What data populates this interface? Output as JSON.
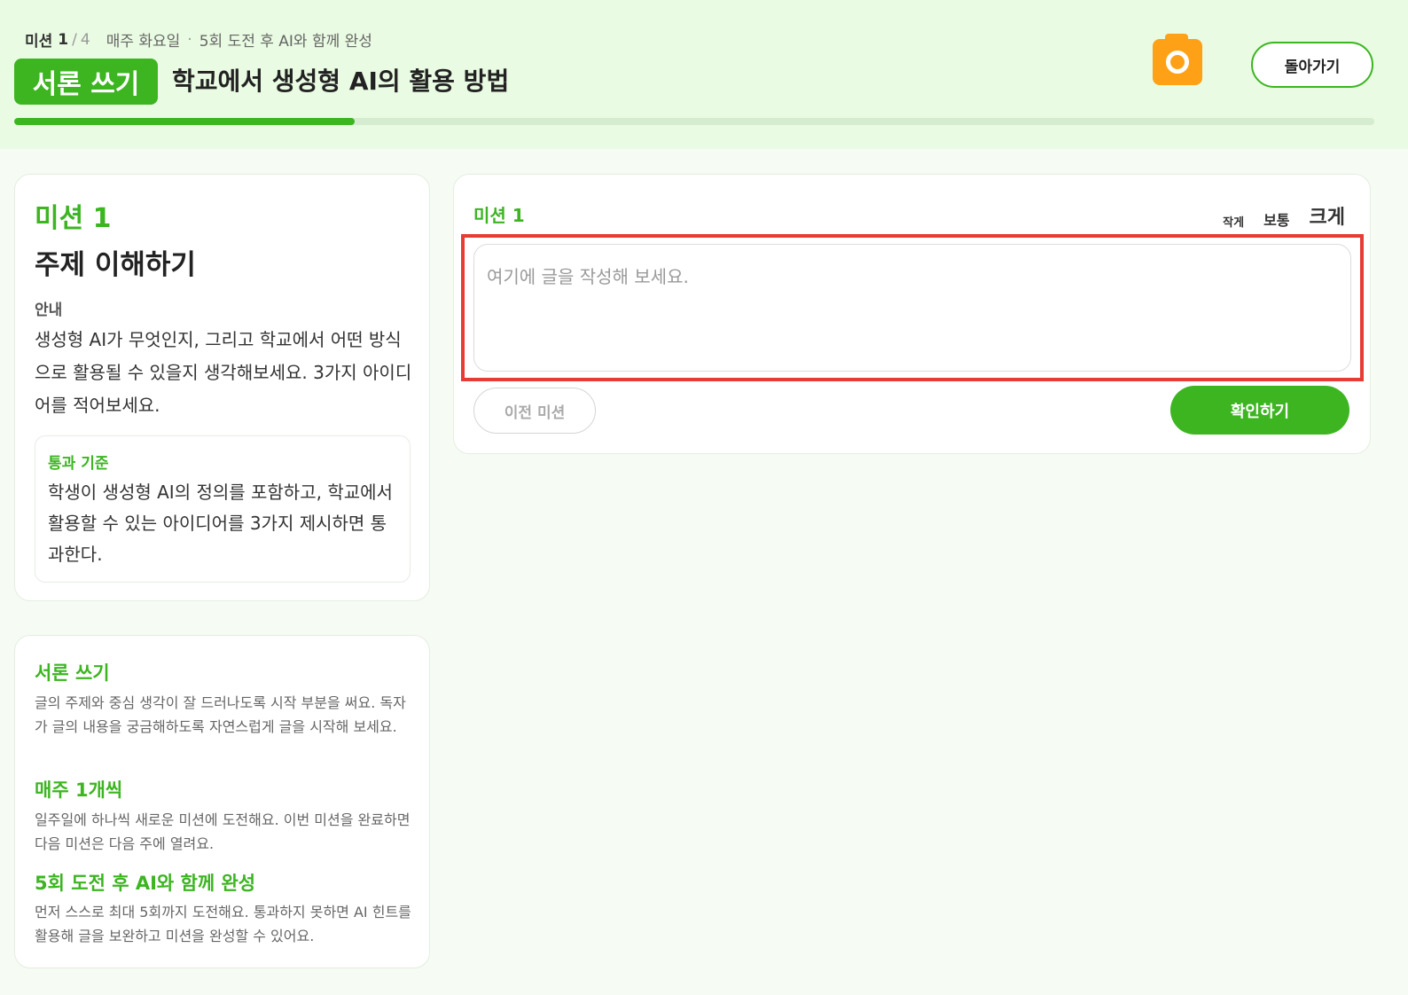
{
  "header": {
    "mission_label": "미션",
    "mission_current": "1",
    "mission_total": "4",
    "schedule": "매주 화요일",
    "rule": "5회 도전 후 AI와 함께 완성",
    "badge": "서론 쓰기",
    "title": "학교에서 생성형 AI의 활용 방법",
    "progress": 0.25,
    "back_label": "돌아가기",
    "camera_icon": "camera-icon",
    "accent_color": "#3cb521",
    "camera_color": "#ffa116"
  },
  "mission_card": {
    "label": "미션 1",
    "title": "주제 이해하기",
    "guide_label": "안내",
    "guide_text": "생성형 AI가 무엇인지, 그리고 학교에서 어떤 방식으로 활용될 수 있을지 생각해보세요. 3가지 아이디어를 적어보세요.",
    "criteria_label": "통과 기준",
    "criteria_text": "학생이 생성형 AI의 정의를 포함하고, 학교에서 활용할 수 있는 아이디어를 3가지 제시하면 통과한다."
  },
  "info_card": {
    "sections": [
      {
        "heading": "서론 쓰기",
        "text": "글의 주제와 중심 생각이 잘 드러나도록 시작 부분을 써요. 독자가 글의 내용을 궁금해하도록 자연스럽게 글을 시작해 보세요."
      },
      {
        "heading": "매주 1개씩",
        "text": "일주일에 하나씩 새로운 미션에 도전해요. 이번 미션을 완료하면 다음 미션은 다음 주에 열려요."
      },
      {
        "heading": "5회 도전 후 AI와 함께 완성",
        "text": "먼저 스스로 최대 5회까지 도전해요. 통과하지 못하면 AI 힌트를 활용해 글을 보완하고 미션을 완성할 수 있어요."
      }
    ]
  },
  "editor": {
    "label": "미션 1",
    "size_small": "작게",
    "size_medium": "보통",
    "size_large": "크게",
    "value": "",
    "placeholder": "여기에 글을 작성해 보세요.",
    "prev_label": "이전 미션",
    "confirm_label": "확인하기",
    "highlight_color": "#e53c33"
  }
}
